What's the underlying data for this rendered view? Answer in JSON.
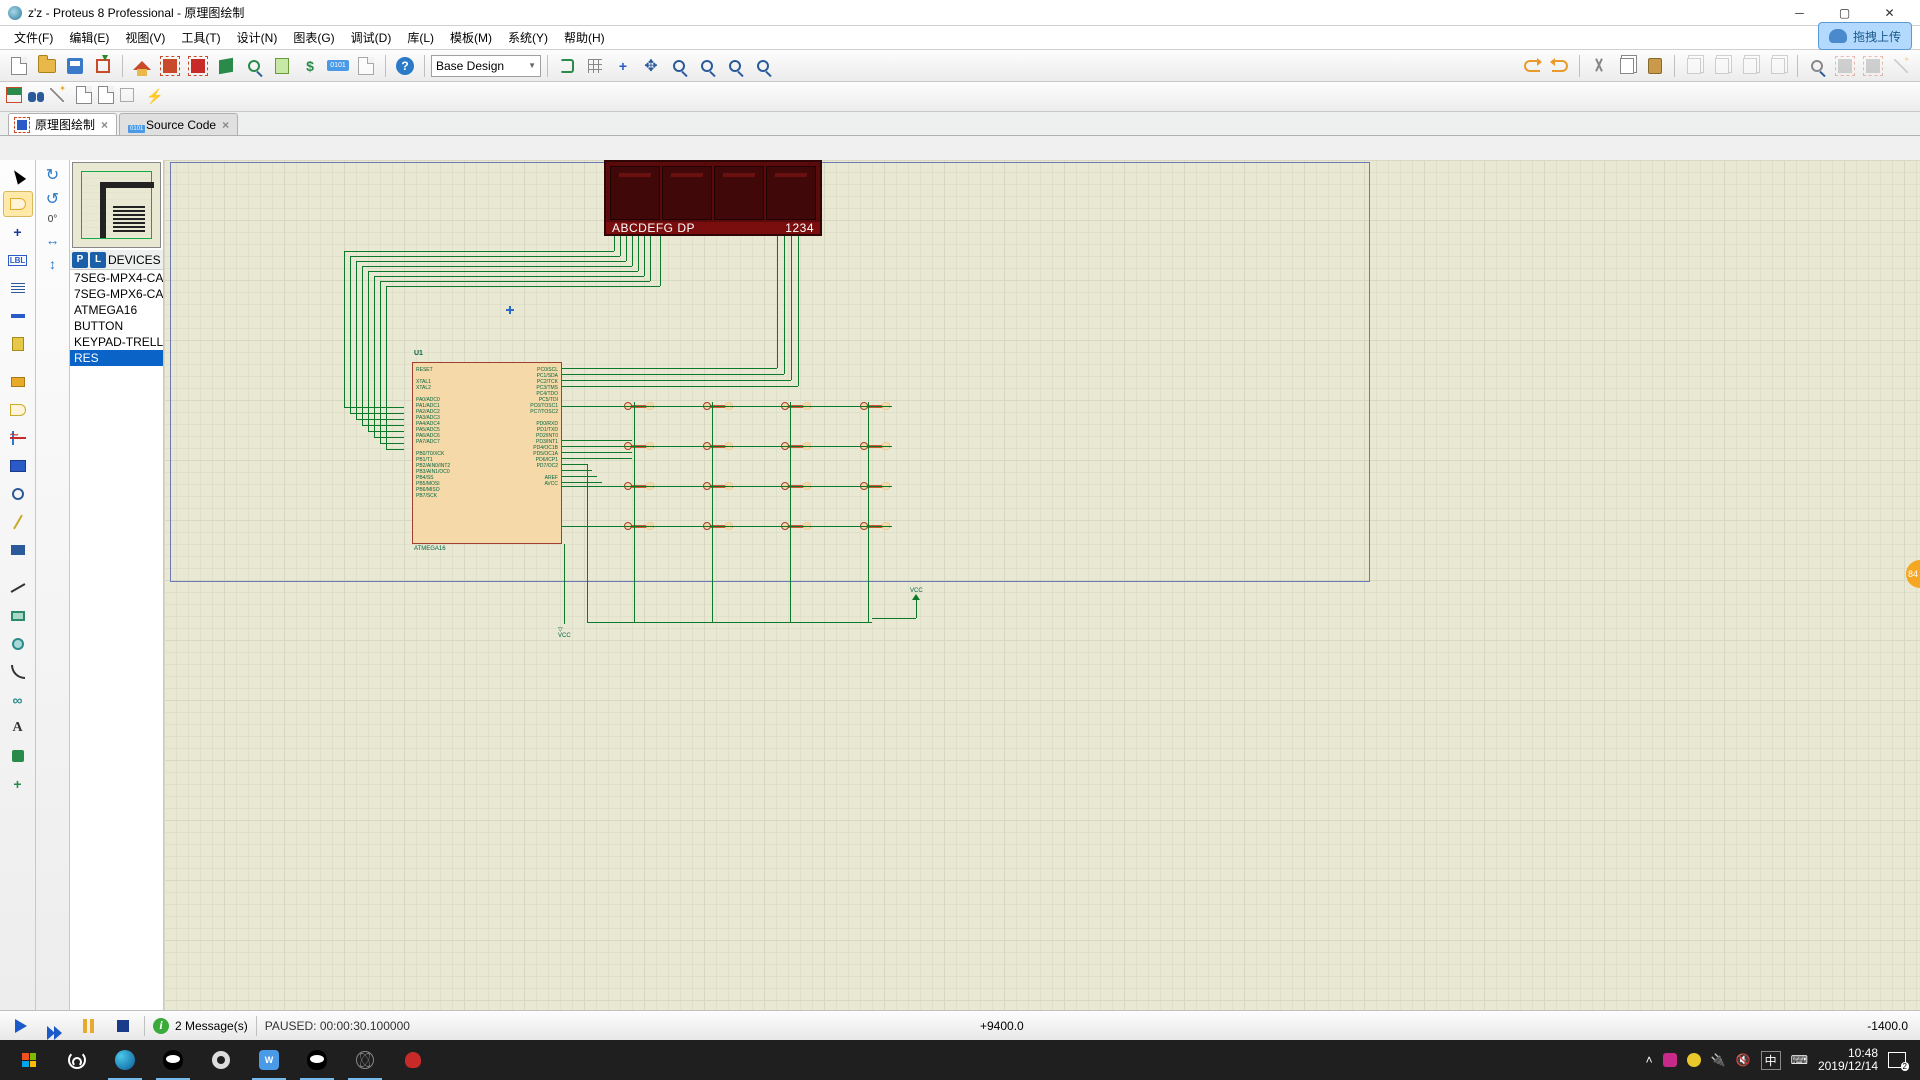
{
  "window": {
    "title": "z'z - Proteus 8 Professional - 原理图绘制"
  },
  "menu": {
    "file": "文件(F)",
    "edit": "编辑(E)",
    "view": "视图(V)",
    "tool": "工具(T)",
    "design": "设计(N)",
    "chart": "图表(G)",
    "debug": "调试(D)",
    "library": "库(L)",
    "template": "模板(M)",
    "system": "系统(Y)",
    "help": "帮助(H)"
  },
  "cloud_badge": "拖拽上传",
  "combo": {
    "design_config": "Base Design"
  },
  "tabs": {
    "schematic": "原理图绘制",
    "source": "Source Code"
  },
  "rotation": "0°",
  "devices": {
    "header": "DEVICES",
    "items": [
      "7SEG-MPX4-CA",
      "7SEG-MPX6-CA",
      "ATMEGA16",
      "BUTTON",
      "KEYPAD-TRELLIS",
      "RES"
    ],
    "selected_index": 5
  },
  "schematic": {
    "ic_ref": "U1",
    "ic_part": "ATMEGA16",
    "seg_labels_left": "ABCDEFG  DP",
    "seg_labels_right": "1234",
    "pins_left": "RESET\n\nXTAL1\nXTAL2\n\nPA0/ADC0\nPA1/ADC1\nPA2/ADC2\nPA3/ADC3\nPA4/ADC4\nPA5/ADC5\nPA6/ADC6\nPA7/ADC7\n\nPB0/T0/XCK\nPB1/T1\nPB2/AIN0/INT2\nPB3/AIN1/OC0\nPB4/SS\nPB5/MOSI\nPB6/MISO\nPB7/SCK",
    "pins_right": "PC0/SCL\nPC1/SDA\nPC2/TCK\nPC3/TMS\nPC4/TDO\nPC5/TDI\nPC6/TOSC1\nPC7/TOSC2\n\nPD0/RXD\nPD1/TXD\nPD2/INT0\nPD3/INT1\nPD4/OC1B\nPD5/OC1A\nPD6/ICP1\nPD7/OC2\n\nAREF\nAVCC",
    "vcc": "VCC"
  },
  "status": {
    "messages": "2 Message(s)",
    "paused": "PAUSED: 00:00:30.100000",
    "coord_x": "+9400.0",
    "coord_y": "-1400.0"
  },
  "taskbar": {
    "ime": "中",
    "time": "10:48",
    "date": "2019/12/14",
    "notif_count": "2"
  }
}
